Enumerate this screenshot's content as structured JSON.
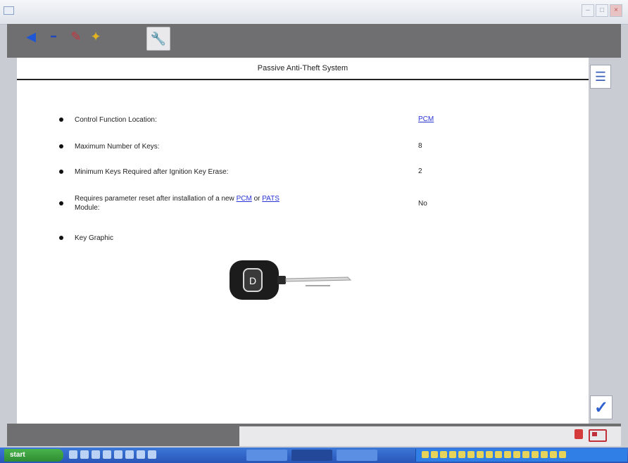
{
  "window": {
    "title": "",
    "buttons": [
      "minimize",
      "maximize",
      "close"
    ]
  },
  "toolbar": {
    "icons": [
      "back-arrow-icon",
      "forward-icon",
      "vehicle-icon",
      "home-icon",
      "wrench-icon"
    ]
  },
  "content": {
    "title": "Passive Anti-Theft System",
    "rows": [
      {
        "label": "Control Function Location:",
        "value": "PCM",
        "value_link": true
      },
      {
        "label": "Maximum Number of Keys:",
        "value": "8"
      },
      {
        "label": "Minimum Keys Required after Ignition Key Erase:",
        "value": "2"
      },
      {
        "label_prefix": "Requires parameter reset after installation of a new ",
        "link1": "PCM",
        "label_mid": " or ",
        "link2": "PATS",
        "label_suffix": " Module:",
        "value": "No"
      },
      {
        "label": "Key Graphic"
      }
    ]
  },
  "taskbar": {
    "start": "start",
    "tasks": [
      "",
      "",
      ""
    ],
    "clock": ""
  }
}
